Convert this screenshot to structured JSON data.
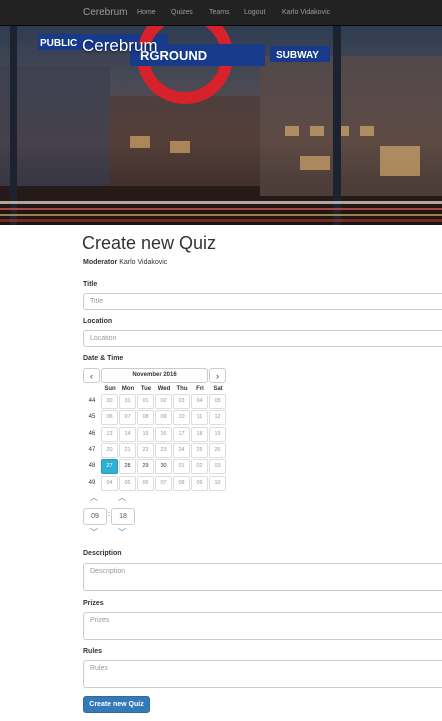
{
  "navbar": {
    "brand": "Cerebrum",
    "links": [
      "Home",
      "Quizes",
      "Teams",
      "Logout",
      "Karlo Vidakovic"
    ]
  },
  "hero": {
    "title": "Cerebrum"
  },
  "page": {
    "title": "Create new Quiz",
    "moderator_label": "Moderator",
    "moderator_name": "Karlo Vidakovic"
  },
  "form": {
    "title_label": "Title",
    "title_placeholder": "Title",
    "location_label": "Location",
    "location_placeholder": "Location",
    "datetime_label": "Date & Time",
    "description_label": "Description",
    "description_placeholder": "Description",
    "prizes_label": "Prizes",
    "prizes_placeholder": "Prizes",
    "rules_label": "Rules",
    "rules_placeholder": "Rules",
    "submit_label": "Create new Quiz"
  },
  "datepicker": {
    "month_label": "November 2016",
    "prev_icon": "‹",
    "next_icon": "›",
    "weekdays": [
      "Sun",
      "Mon",
      "Tue",
      "Wed",
      "Thu",
      "Fri",
      "Sat"
    ],
    "weeks": [
      {
        "num": "44",
        "days": [
          "30",
          "31",
          "01",
          "02",
          "03",
          "04",
          "05"
        ]
      },
      {
        "num": "45",
        "days": [
          "06",
          "07",
          "08",
          "09",
          "10",
          "11",
          "12"
        ]
      },
      {
        "num": "46",
        "days": [
          "13",
          "14",
          "15",
          "16",
          "17",
          "18",
          "19"
        ]
      },
      {
        "num": "47",
        "days": [
          "20",
          "21",
          "22",
          "23",
          "24",
          "25",
          "26"
        ]
      },
      {
        "num": "48",
        "days": [
          "27",
          "28",
          "29",
          "30",
          "01",
          "02",
          "03"
        ]
      },
      {
        "num": "49",
        "days": [
          "04",
          "05",
          "06",
          "07",
          "08",
          "09",
          "10"
        ]
      }
    ],
    "selected_day": "27",
    "time_hour": "09",
    "time_minute": "18",
    "time_separator": ":",
    "chevron_up": "︿",
    "chevron_down": "﹀"
  },
  "colors": {
    "navbar_bg": "#222222",
    "primary": "#337ab7",
    "selected_day": "#31b0d5"
  }
}
